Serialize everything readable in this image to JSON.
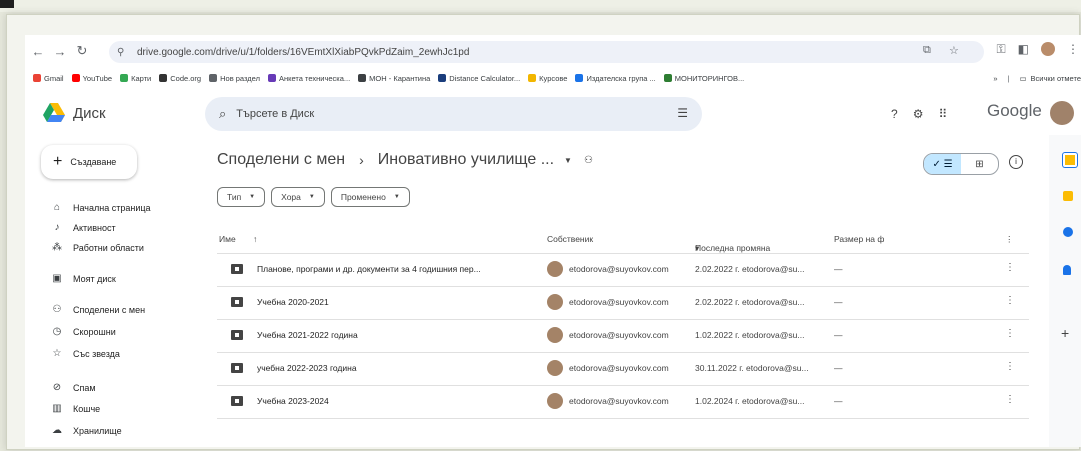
{
  "browser": {
    "url": "drive.google.com/drive/u/1/folders/16VEmtXlXiabPQvkPdZaim_2ewhJc1pd",
    "bookmarks": [
      {
        "label": "Gmail",
        "color": "#ea4335"
      },
      {
        "label": "YouTube",
        "color": "#ff0000"
      },
      {
        "label": "Карти",
        "color": "#34a853"
      },
      {
        "label": "Code.org",
        "color": "#333333"
      },
      {
        "label": "Нов раздел",
        "color": "#5f6368"
      },
      {
        "label": "Анкета техническа...",
        "color": "#673ab7"
      },
      {
        "label": "МОН - Карантина",
        "color": "#3c4043"
      },
      {
        "label": "Distance Calculator...",
        "color": "#1a3d7c"
      },
      {
        "label": "Курсове",
        "color": "#f2b600"
      },
      {
        "label": "Издателска група ...",
        "color": "#1a73e8"
      },
      {
        "label": "МОНИТОРИНГОВ...",
        "color": "#2e7d32"
      }
    ],
    "bookmarks_more": "»",
    "other_bookmarks": "Всички отмете"
  },
  "drive": {
    "app_name": "Диск",
    "search_placeholder": "Търсете в Диск",
    "google_label": "Google",
    "create_label": "Създаване",
    "nav": [
      {
        "label": "Начална страница",
        "icon": "home-icon",
        "glyph": "⌂"
      },
      {
        "label": "Активност",
        "icon": "bell-icon",
        "glyph": "♪"
      },
      {
        "label": "Работни области",
        "icon": "workspaces-icon",
        "glyph": "⁂"
      },
      {
        "label": "Моят диск",
        "icon": "my-drive-icon",
        "glyph": "▣"
      },
      {
        "label": "Споделени с мен",
        "icon": "shared-icon",
        "glyph": "⚇"
      },
      {
        "label": "Скорошни",
        "icon": "clock-icon",
        "glyph": "◷"
      },
      {
        "label": "Със звезда",
        "icon": "star-icon",
        "glyph": "☆"
      },
      {
        "label": "Спам",
        "icon": "spam-icon",
        "glyph": "⊘"
      },
      {
        "label": "Кошче",
        "icon": "trash-icon",
        "glyph": "▥"
      },
      {
        "label": "Хранилище",
        "icon": "cloud-icon",
        "glyph": "☁"
      }
    ],
    "breadcrumb_root": "Споделени с мен",
    "breadcrumb_sep": "›",
    "breadcrumb_current": "Иновативно училище ...",
    "filters": [
      "Тип",
      "Хора",
      "Променено"
    ],
    "columns": {
      "name": "Име",
      "sort_arrow": "↑",
      "owner": "Собственик",
      "modified": "Последна промяна",
      "modified_arrow": "▾",
      "size": "Размер на ф"
    },
    "rows": [
      {
        "name": "Планове, програми и др. документи за 4 годишния пер...",
        "owner": "etodorova@suyovkov.com",
        "modified": "2.02.2022 г. etodorova@su...",
        "size": "—"
      },
      {
        "name": "Учебна 2020-2021",
        "owner": "etodorova@suyovkov.com",
        "modified": "2.02.2022 г. etodorova@su...",
        "size": "—"
      },
      {
        "name": "Учебна 2021-2022 година",
        "owner": "etodorova@suyovkov.com",
        "modified": "1.02.2022 г. etodorova@su...",
        "size": "—"
      },
      {
        "name": "учебна 2022-2023 година",
        "owner": "etodorova@suyovkov.com",
        "modified": "30.11.2022 г. etodorova@su...",
        "size": "—"
      },
      {
        "name": "Учебна 2023-2024",
        "owner": "etodorova@suyovkov.com",
        "modified": "1.02.2024 г. etodorova@su...",
        "size": "—"
      }
    ]
  }
}
